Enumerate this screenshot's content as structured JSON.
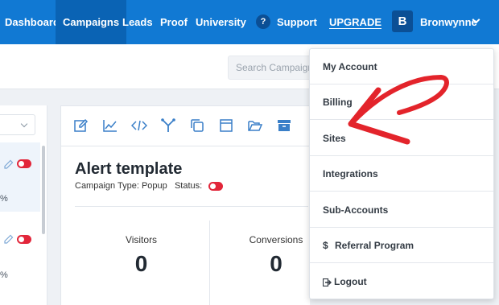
{
  "nav": {
    "items": [
      {
        "label": "Dashboard",
        "active": false
      },
      {
        "label": "Campaigns",
        "active": true
      },
      {
        "label": "Leads",
        "active": false
      },
      {
        "label": "Proof",
        "active": false
      },
      {
        "label": "University",
        "active": false
      }
    ],
    "help_glyph": "?",
    "support_label": "Support",
    "upgrade_label": "UPGRADE",
    "avatar_initial": "B",
    "user_name": "Bronwynne",
    "color": "#1179d3"
  },
  "search": {
    "placeholder": "Search Campaigns"
  },
  "left_panel": {
    "rows": [
      {
        "percent_suffix": "%"
      },
      {
        "percent_suffix": "%"
      }
    ]
  },
  "campaign": {
    "toolbar_icons": [
      "edit-icon",
      "chart-icon",
      "code-icon",
      "split-icon",
      "duplicate-icon",
      "window-icon",
      "folder-icon",
      "archive-icon"
    ],
    "title": "Alert template",
    "type_text": "Campaign Type: Popup",
    "status_label": "Status:",
    "status_color": "#e2263a",
    "stats": [
      {
        "label": "Visitors",
        "value": "0"
      },
      {
        "label": "Conversions",
        "value": "0"
      }
    ]
  },
  "account_menu": {
    "items": [
      {
        "label": "My Account",
        "icon": ""
      },
      {
        "label": "Billing",
        "icon": ""
      },
      {
        "label": "Sites",
        "icon": ""
      },
      {
        "label": "Integrations",
        "icon": ""
      },
      {
        "label": "Sub-Accounts",
        "icon": ""
      },
      {
        "label": "Referral Program",
        "icon": "$"
      },
      {
        "label": "Logout",
        "icon": "logout-icon"
      }
    ]
  },
  "annotation": {
    "arrow_color": "#e3242b",
    "points_to": "Sites"
  }
}
